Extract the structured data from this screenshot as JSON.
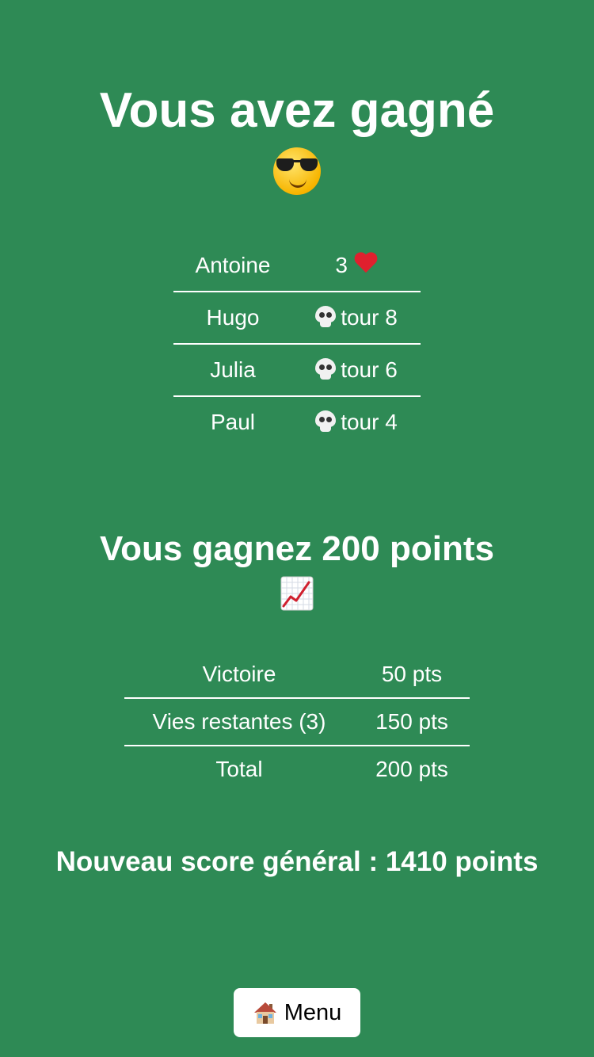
{
  "result": {
    "title": "Vous avez gagné",
    "title_icon": "smiling-face-with-sunglasses-icon"
  },
  "players": [
    {
      "name": "Antoine",
      "status_icon": "heart-icon",
      "status_text": "3",
      "status_color": "#e0202e"
    },
    {
      "name": "Hugo",
      "status_icon": "skull-icon",
      "status_text": "tour 8"
    },
    {
      "name": "Julia",
      "status_icon": "skull-icon",
      "status_text": "tour 6"
    },
    {
      "name": "Paul",
      "status_icon": "skull-icon",
      "status_text": "tour 4"
    }
  ],
  "points": {
    "title": "Vous gagnez 200 points",
    "title_icon": "chart-increasing-icon",
    "rows": [
      {
        "label": "Victoire",
        "value": "50 pts"
      },
      {
        "label": "Vies restantes (3)",
        "value": "150 pts"
      },
      {
        "label": "Total",
        "value": "200 pts"
      }
    ]
  },
  "total_score": {
    "text": "Nouveau score général : 1410 points"
  },
  "menu_button": {
    "label": "Menu",
    "icon": "house-icon"
  },
  "colors": {
    "background": "#2e8a55",
    "text": "#ffffff",
    "button_background": "#ffffff",
    "button_text": "#000000"
  }
}
